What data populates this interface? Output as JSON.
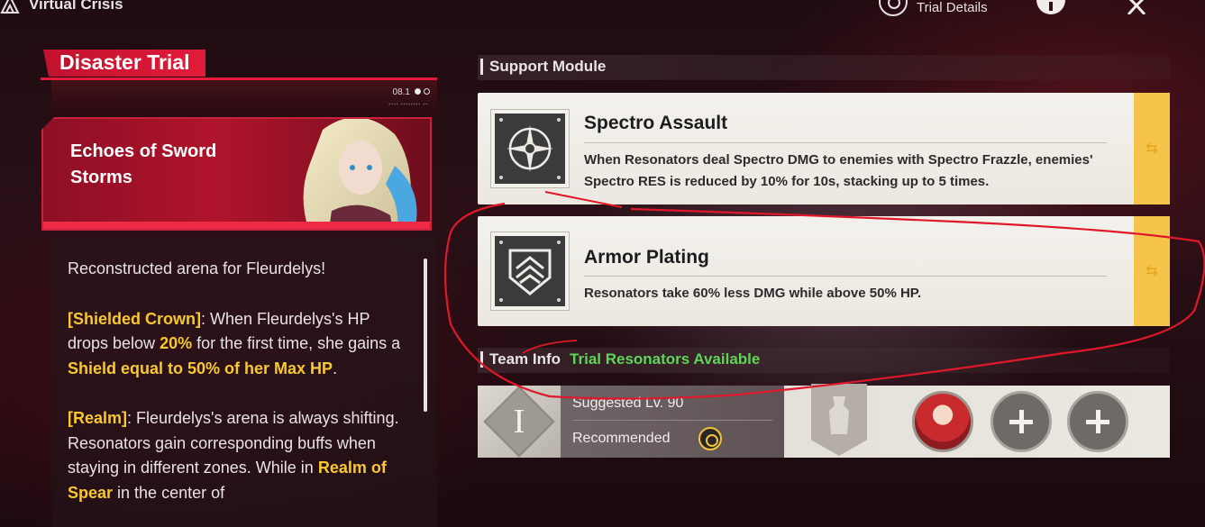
{
  "topbar": {
    "title": "Virtual Crisis",
    "trial_details_label": "Trial Details",
    "icons": [
      "game-logo-icon",
      "search-icon",
      "info-icon",
      "close-icon"
    ]
  },
  "left": {
    "header_title": "Disaster Trial",
    "stage_page": "08.1",
    "page_dots": 2,
    "active_dot": 1,
    "banner_title": "Echoes of Sword Storms",
    "description": {
      "intro": "Reconstructed arena for Fleurdelys!",
      "p2": {
        "tag": "[Shielded Crown]",
        "t1": ": When Fleurdelys's HP drops below ",
        "pct": "20%",
        "t2": " for the first time, she gains a ",
        "shield": "Shield equal to 50% of her Max HP",
        "t3": "."
      },
      "p3": {
        "tag": "[Realm]",
        "t1": ": Fleurdelys's arena is always shifting. Resonators gain corresponding buffs when staying in different zones. While in ",
        "realm": "Realm of Spear",
        "t2": " in the center of"
      }
    }
  },
  "support": {
    "heading": "Support Module",
    "modules": [
      {
        "title": "Spectro Assault",
        "desc": "When Resonators deal Spectro DMG to enemies with Spectro Frazzle, enemies' Spectro RES is reduced by 10% for 10s, stacking up to 5 times.",
        "icon": "spectro-compass-icon"
      },
      {
        "title": "Armor Plating",
        "desc": "Resonators take 60% less DMG while above 50% HP.",
        "icon": "armor-shield-icon"
      }
    ],
    "swap_glyph": "⇆"
  },
  "team": {
    "heading": "Team Info",
    "trial_text": "Trial Resonators Available",
    "tier": "I",
    "suggested": "Suggested Lv. 90",
    "recommended": "Recommended"
  },
  "colors": {
    "accent_red": "#e21c3a",
    "highlight_yellow": "#f8c830",
    "swap_yellow": "#f5c44a",
    "trial_green": "#5fd45a",
    "annotation_red": "#e0182a"
  }
}
